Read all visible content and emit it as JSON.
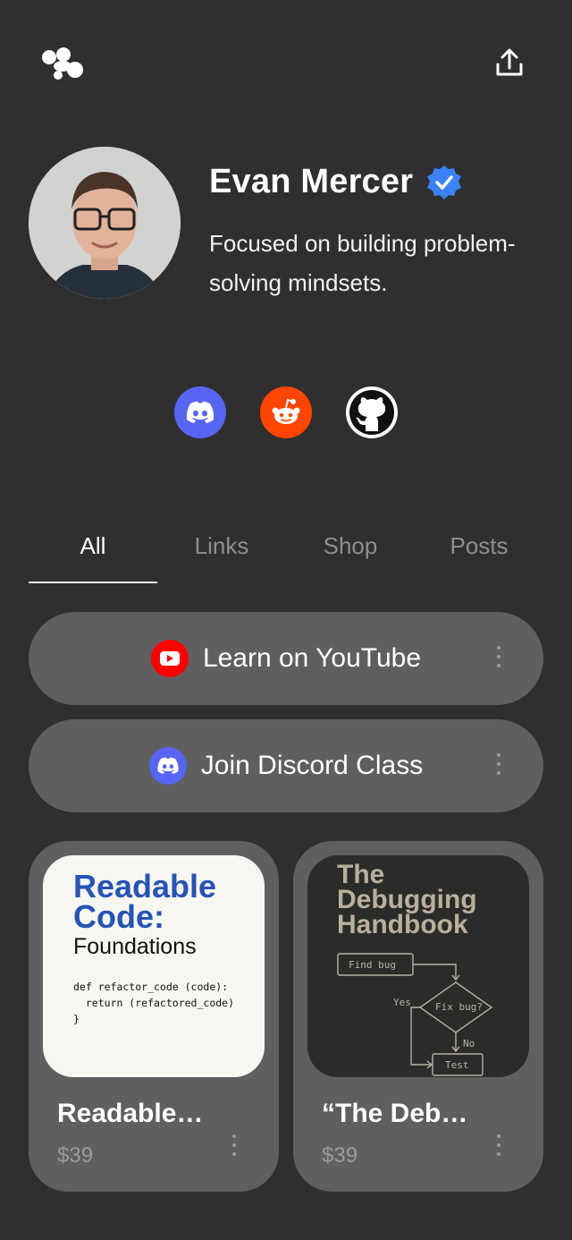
{
  "header": {
    "logo_icon": "linktree-cluster-icon",
    "share_icon": "share-upload-icon"
  },
  "profile": {
    "name": "Evan Mercer",
    "verified_icon": "verified-badge-icon",
    "verified_color": "#3b82f6",
    "bio": "Focused on building problem-solving mindsets."
  },
  "socials": [
    {
      "name": "discord",
      "icon": "discord-icon",
      "color": "#5865f2"
    },
    {
      "name": "reddit",
      "icon": "reddit-icon",
      "color": "#ff4500"
    },
    {
      "name": "github",
      "icon": "github-icon",
      "color": "#ffffff"
    }
  ],
  "tabs": [
    {
      "label": "All",
      "active": true
    },
    {
      "label": "Links",
      "active": false
    },
    {
      "label": "Shop",
      "active": false
    },
    {
      "label": "Posts",
      "active": false
    }
  ],
  "links": [
    {
      "label": "Learn on YouTube",
      "icon": "youtube-icon",
      "color": "#ff0000"
    },
    {
      "label": "Join Discord Class",
      "icon": "discord-icon",
      "color": "#5865f2"
    }
  ],
  "products": [
    {
      "title": "Readable…",
      "price": "$39",
      "cover": {
        "heading_line1": "Readable",
        "heading_line2": "Code:",
        "subtitle": "Foundations",
        "code": "def refactor_code (code):\n  return (refactored_code)\n}"
      }
    },
    {
      "title": "“The Deb…",
      "price": "$39",
      "cover": {
        "heading_line1": "The",
        "heading_line2": "Debugging",
        "heading_line3": "Handbook",
        "flow_find": "Find bug",
        "flow_yes": "Yes",
        "flow_fix": "Fix bug?",
        "flow_no": "No",
        "flow_test": "Test"
      }
    }
  ]
}
